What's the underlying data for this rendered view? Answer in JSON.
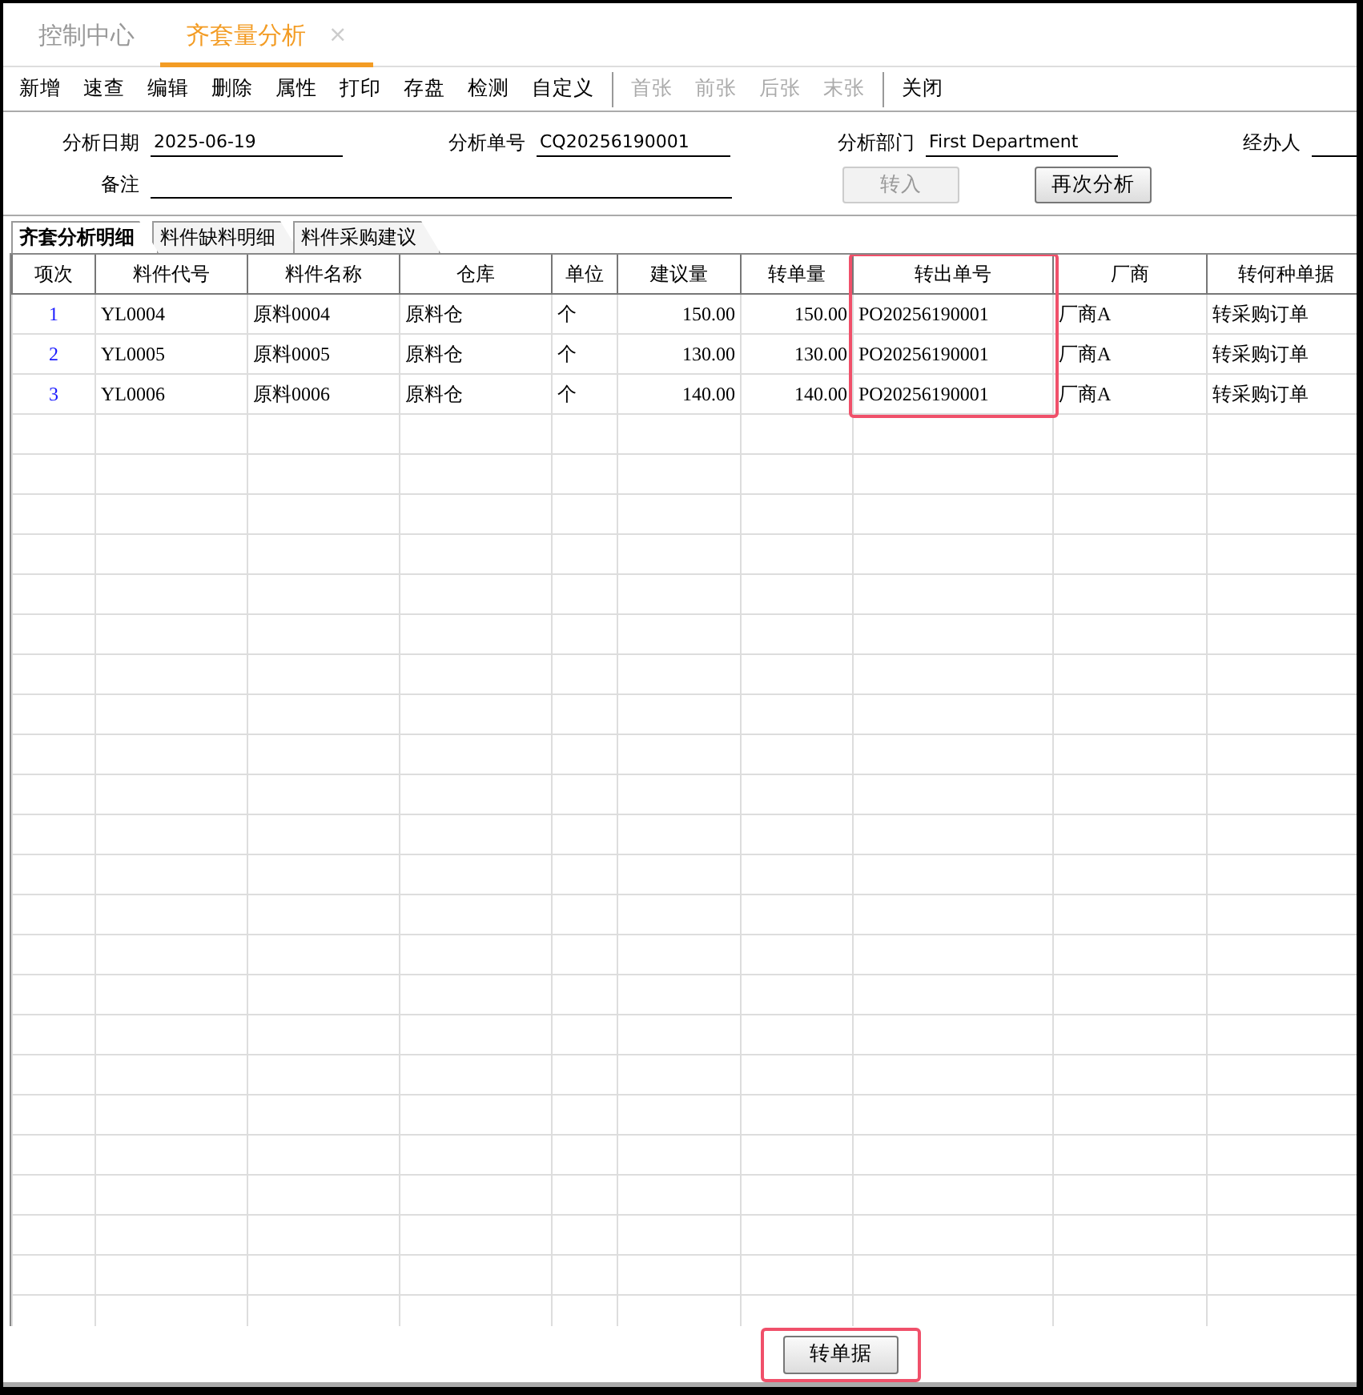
{
  "tabs": [
    {
      "label": "控制中心",
      "selected": false
    },
    {
      "label": "齐套量分析",
      "selected": true,
      "close_label": "×"
    }
  ],
  "toolbar": [
    {
      "kind": "button",
      "label": "新增",
      "disabled": false
    },
    {
      "kind": "button",
      "label": "速查",
      "disabled": false
    },
    {
      "kind": "button",
      "label": "编辑",
      "disabled": false
    },
    {
      "kind": "button",
      "label": "删除",
      "disabled": false
    },
    {
      "kind": "button",
      "label": "属性",
      "disabled": false
    },
    {
      "kind": "button",
      "label": "打印",
      "disabled": false
    },
    {
      "kind": "button",
      "label": "存盘",
      "disabled": false
    },
    {
      "kind": "button",
      "label": "检测",
      "disabled": false
    },
    {
      "kind": "button",
      "label": "自定义",
      "disabled": false
    },
    {
      "kind": "separator"
    },
    {
      "kind": "button",
      "label": "首张",
      "disabled": true
    },
    {
      "kind": "button",
      "label": "前张",
      "disabled": true
    },
    {
      "kind": "button",
      "label": "后张",
      "disabled": true
    },
    {
      "kind": "button",
      "label": "末张",
      "disabled": true
    },
    {
      "kind": "separator"
    },
    {
      "kind": "button",
      "label": "关闭",
      "disabled": false
    }
  ],
  "form": {
    "fields": [
      {
        "label": "分析日期",
        "value": "2025-06-19"
      },
      {
        "label": "分析单号",
        "value": "CQ20256190001"
      },
      {
        "label": "分析部门",
        "value": "First Department"
      },
      {
        "label": "经办人"
      }
    ],
    "remark": {
      "label": "备注"
    },
    "buttons": [
      {
        "label": "转入",
        "disabled": true
      },
      {
        "label": "再次分析",
        "disabled": false
      }
    ]
  },
  "sub_tabs": [
    {
      "label": "齐套分析明细",
      "selected": true
    },
    {
      "label": "料件缺料明细",
      "selected": false
    },
    {
      "label": "料件采购建议",
      "selected": false
    }
  ],
  "table": {
    "columns": [
      {
        "label": "项次",
        "highlighted": false
      },
      {
        "label": "料件代号",
        "highlighted": false
      },
      {
        "label": "料件名称",
        "highlighted": false
      },
      {
        "label": "仓库",
        "highlighted": false
      },
      {
        "label": "单位",
        "highlighted": false
      },
      {
        "label": "建议量",
        "highlighted": false
      },
      {
        "label": "转单量",
        "highlighted": false
      },
      {
        "label": "转出单号",
        "highlighted": true
      },
      {
        "label": "厂商",
        "highlighted": false
      },
      {
        "label": "转何种单据",
        "highlighted": false
      }
    ],
    "rows": [
      [
        "1",
        "YL0004",
        "原料0004",
        "原料仓",
        "个",
        "150.00",
        "150.00",
        "PO20256190001",
        "厂商A",
        "转采购订单"
      ],
      [
        "2",
        "YL0005",
        "原料0005",
        "原料仓",
        "个",
        "130.00",
        "130.00",
        "PO20256190001",
        "厂商A",
        "转采购订单"
      ],
      [
        "3",
        "YL0006",
        "原料0006",
        "原料仓",
        "个",
        "140.00",
        "140.00",
        "PO20256190001",
        "厂商A",
        "转采购订单"
      ]
    ]
  },
  "footer_button": {
    "label": "转单据",
    "highlighted": true
  }
}
